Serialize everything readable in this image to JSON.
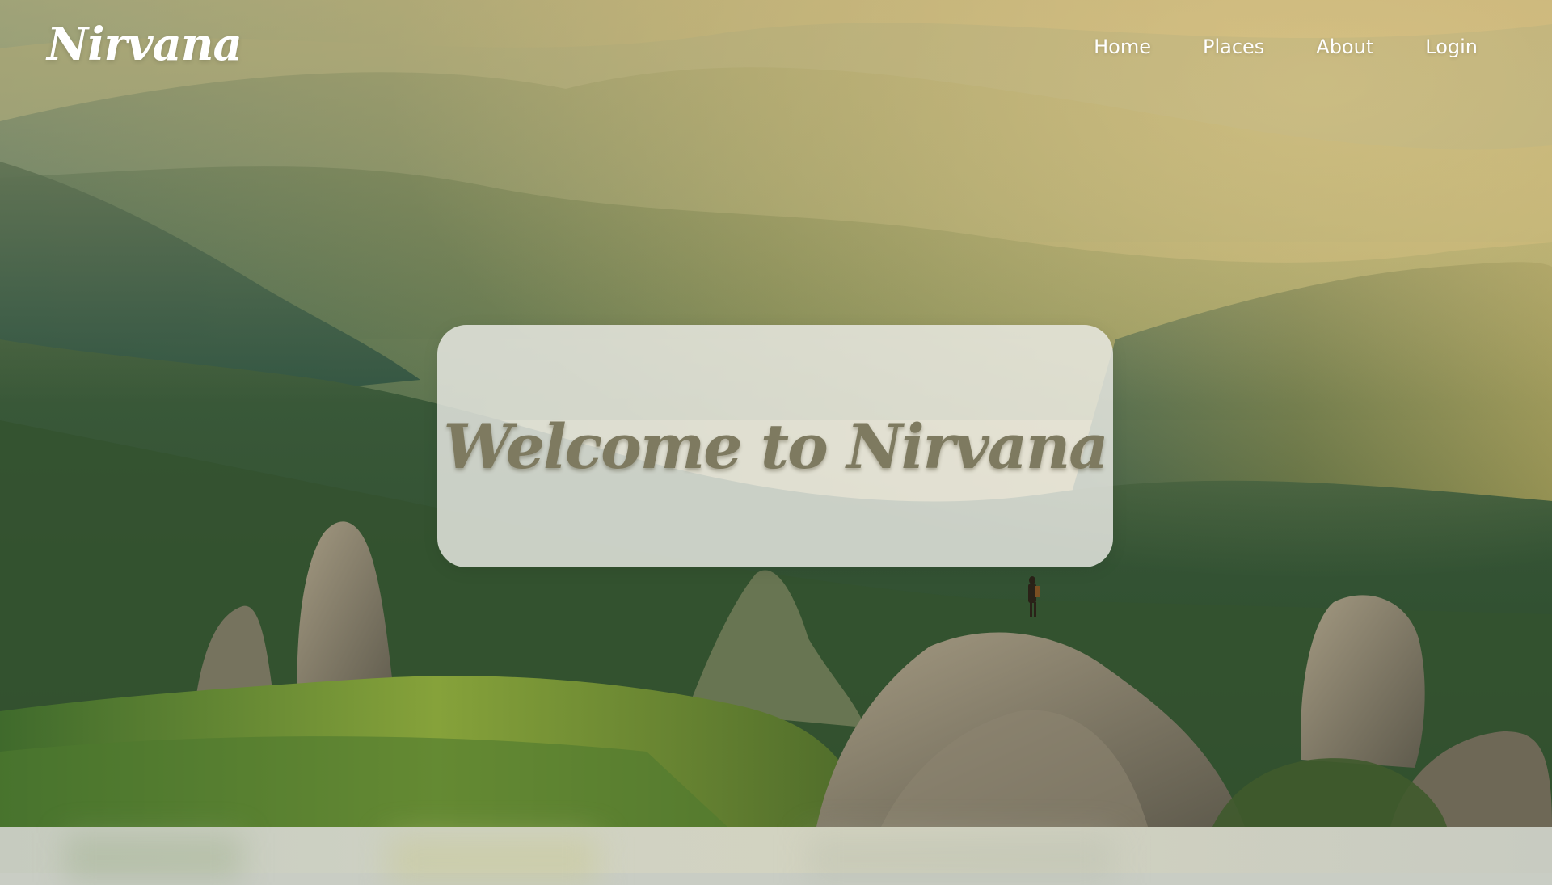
{
  "navbar": {
    "logo": "Nirvana",
    "links": [
      {
        "label": "Home"
      },
      {
        "label": "Places"
      },
      {
        "label": "About"
      },
      {
        "label": "Login"
      }
    ]
  },
  "hero": {
    "title": "Welcome to Nirvana",
    "background": "mountain-landscape-image"
  },
  "colors": {
    "nav_text": "#ffffff",
    "title_text": "#7e7a60",
    "card_background": "#ebebe6"
  }
}
